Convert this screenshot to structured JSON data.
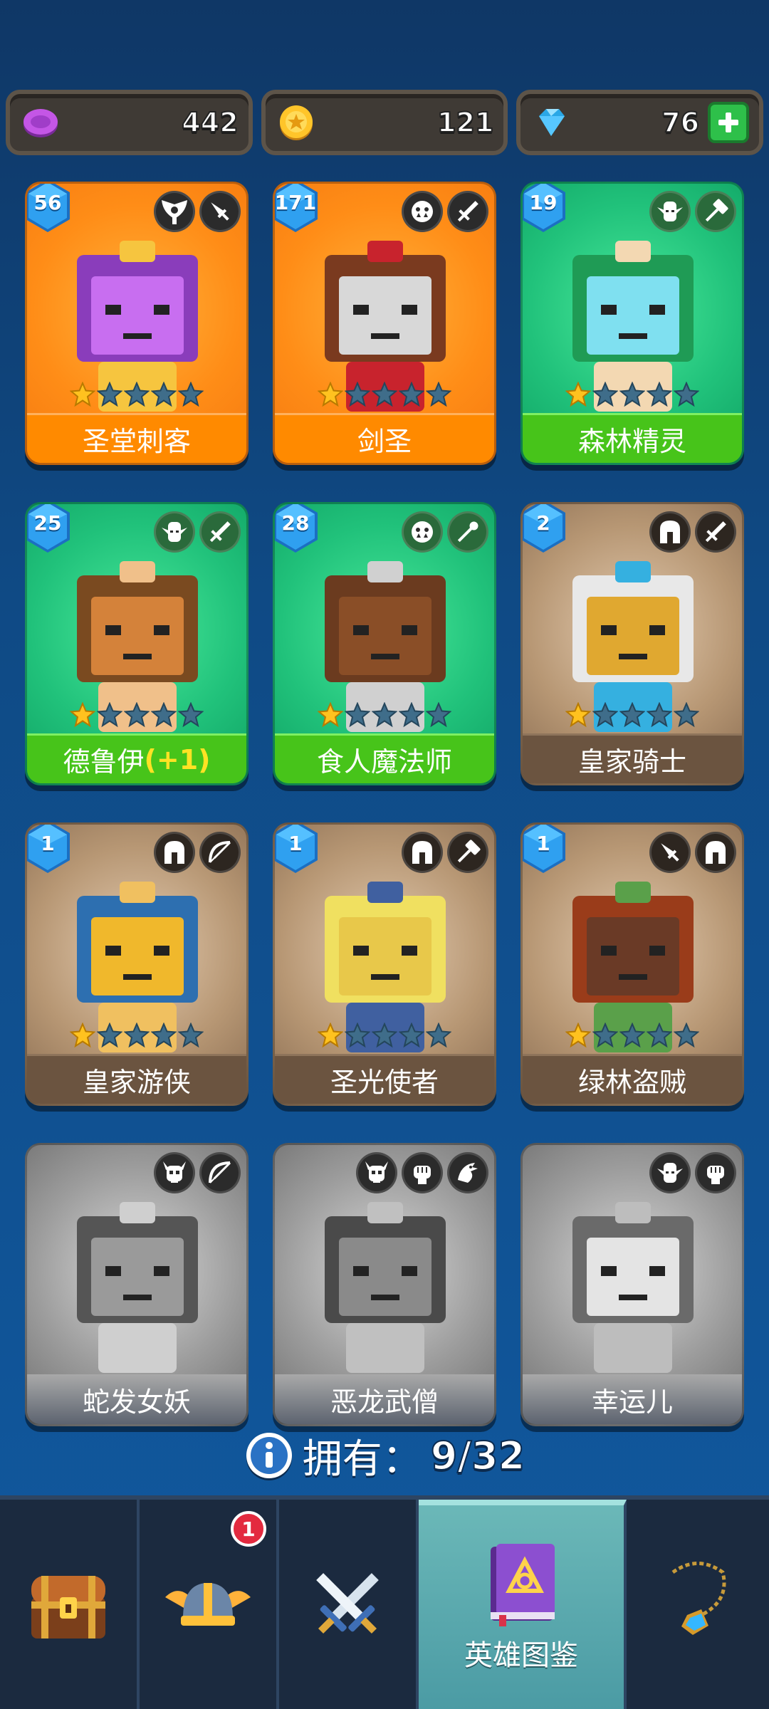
{
  "currency": {
    "gems_purple": "442",
    "coins": "121",
    "diamonds": "76"
  },
  "heroes": [
    {
      "name": "圣堂刺客",
      "level": "56",
      "stars": 1,
      "theme": "orange",
      "icons": [
        "wings-emblem-icon",
        "dagger-icon"
      ],
      "owned": true
    },
    {
      "name": "剑圣",
      "level": "171",
      "stars": 1,
      "theme": "orange",
      "icons": [
        "orc-face-icon",
        "sword-icon"
      ],
      "owned": true
    },
    {
      "name": "森林精灵",
      "level": "19",
      "stars": 1,
      "theme": "green",
      "icons": [
        "elf-face-icon",
        "hammer-icon"
      ],
      "owned": true
    },
    {
      "name": "德鲁伊",
      "name_suffix": "(+1)",
      "level": "25",
      "stars": 1,
      "theme": "green",
      "icons": [
        "elf-face-icon",
        "sword-icon"
      ],
      "owned": true
    },
    {
      "name": "食人魔法师",
      "level": "28",
      "stars": 1,
      "theme": "green",
      "icons": [
        "orc-face-icon",
        "wand-icon"
      ],
      "owned": true
    },
    {
      "name": "皇家骑士",
      "level": "2",
      "stars": 1,
      "theme": "tan",
      "icons": [
        "helmet-icon",
        "sword-icon"
      ],
      "owned": true
    },
    {
      "name": "皇家游侠",
      "level": "1",
      "stars": 1,
      "theme": "tan",
      "icons": [
        "helmet-icon",
        "bow-icon"
      ],
      "owned": true
    },
    {
      "name": "圣光使者",
      "level": "1",
      "stars": 1,
      "theme": "tan",
      "icons": [
        "helmet-icon",
        "hammer-icon"
      ],
      "owned": true
    },
    {
      "name": "绿林盗贼",
      "level": "1",
      "stars": 1,
      "theme": "tan",
      "icons": [
        "dagger-icon",
        "helmet-icon"
      ],
      "owned": true
    },
    {
      "name": "蛇发女妖",
      "theme": "gray",
      "icons": [
        "skull-horned-icon",
        "bow-icon"
      ],
      "owned": false
    },
    {
      "name": "恶龙武僧",
      "theme": "gray",
      "icons": [
        "skull-horned-icon",
        "fist-icon",
        "dragon-icon"
      ],
      "owned": false
    },
    {
      "name": "幸运儿",
      "theme": "gray",
      "icons": [
        "elf-face-icon",
        "fist-icon"
      ],
      "owned": false
    }
  ],
  "owned_label": "拥有：",
  "owned_value": "9/32",
  "nav": {
    "items": [
      {
        "name": "chest-tab",
        "icon": "treasure-chest-icon"
      },
      {
        "name": "heroes-tab",
        "icon": "winged-helmet-icon",
        "badge": "1"
      },
      {
        "name": "battle-tab",
        "icon": "crossed-swords-icon"
      },
      {
        "name": "codex-tab",
        "icon": "codex-book-icon",
        "label": "英雄图鉴",
        "active": true
      },
      {
        "name": "amulet-tab",
        "icon": "amulet-icon"
      }
    ]
  }
}
